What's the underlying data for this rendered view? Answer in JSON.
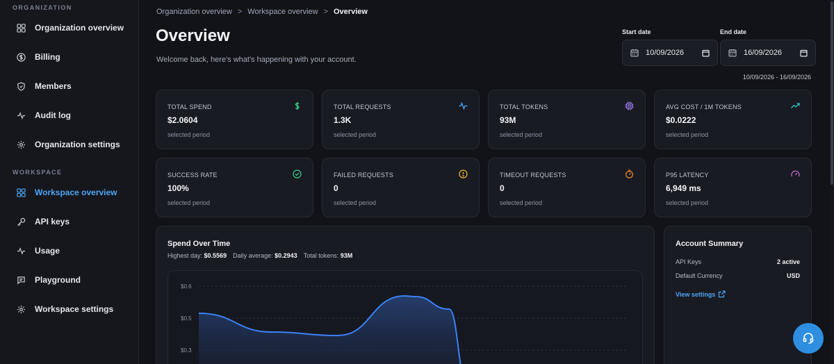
{
  "sidebar": {
    "org_section": "ORGANIZATION",
    "ws_section": "WORKSPACE",
    "org_items": [
      {
        "label": "Organization overview",
        "icon": "grid-icon"
      },
      {
        "label": "Billing",
        "icon": "dollar-circle-icon"
      },
      {
        "label": "Members",
        "icon": "shield-icon"
      },
      {
        "label": "Audit log",
        "icon": "activity-icon"
      },
      {
        "label": "Organization settings",
        "icon": "gear-icon"
      }
    ],
    "ws_items": [
      {
        "label": "Workspace overview",
        "icon": "grid-icon",
        "active": true
      },
      {
        "label": "API keys",
        "icon": "key-icon"
      },
      {
        "label": "Usage",
        "icon": "activity-icon"
      },
      {
        "label": "Playground",
        "icon": "chat-icon"
      },
      {
        "label": "Workspace settings",
        "icon": "gear-icon"
      }
    ]
  },
  "breadcrumb": {
    "items": [
      "Organization overview",
      "Workspace overview",
      "Overview"
    ],
    "separator": ">"
  },
  "header": {
    "title": "Overview",
    "subtitle": "Welcome back, here's what's happening with your account."
  },
  "dates": {
    "start_label": "Start date",
    "start_value": "10/09/2026",
    "end_label": "End date",
    "end_value": "16/09/2026",
    "range_text": "10/09/2026 - 16/09/2026"
  },
  "cards": [
    {
      "label": "TOTAL SPEND",
      "value": "$2.0604",
      "sub": "selected period",
      "icon": "dollar-icon",
      "color": "#3ecf8e"
    },
    {
      "label": "TOTAL REQUESTS",
      "value": "1.3K",
      "sub": "selected period",
      "icon": "activity-icon",
      "color": "#4ea5f5"
    },
    {
      "label": "TOTAL TOKENS",
      "value": "93M",
      "sub": "selected period",
      "icon": "cpu-icon",
      "color": "#9b7bf0"
    },
    {
      "label": "AVG COST / 1M TOKENS",
      "value": "$0.0222",
      "sub": "selected period",
      "icon": "trending-up-icon",
      "color": "#2cc5c5"
    },
    {
      "label": "SUCCESS RATE",
      "value": "100%",
      "sub": "selected period",
      "icon": "check-circle-icon",
      "color": "#3ecf8e"
    },
    {
      "label": "FAILED REQUESTS",
      "value": "0",
      "sub": "selected period",
      "icon": "alert-circle-icon",
      "color": "#f2b531"
    },
    {
      "label": "TIMEOUT REQUESTS",
      "value": "0",
      "sub": "selected period",
      "icon": "timer-icon",
      "color": "#f28b31"
    },
    {
      "label": "P95 LATENCY",
      "value": "6,949 ms",
      "sub": "selected period",
      "icon": "gauge-icon",
      "color": "#d46ad8"
    }
  ],
  "spend_panel": {
    "title": "Spend Over Time",
    "highest_label": "Highest day:",
    "highest_value": "$0.5569",
    "avg_label": "Daily average:",
    "avg_value": "$0.2943",
    "tokens_label": "Total tokens:",
    "tokens_value": "93M"
  },
  "chart_data": {
    "type": "area",
    "ylim": [
      0.3,
      0.6
    ],
    "yticks": [
      "$0.6",
      "$0.5",
      "$0.3"
    ],
    "series": [
      {
        "values": [
          0.5194,
          0.4594,
          0.4464,
          0.5569,
          0.5494,
          0.5094,
          0.0
        ]
      }
    ],
    "grid": true,
    "color": "#3b82f6"
  },
  "summary": {
    "title": "Account Summary",
    "rows": [
      {
        "label": "API Keys",
        "value": "2 active"
      },
      {
        "label": "Default Currency",
        "value": "USD"
      }
    ],
    "link": "View settings"
  },
  "support": {
    "icon": "headset-icon"
  }
}
